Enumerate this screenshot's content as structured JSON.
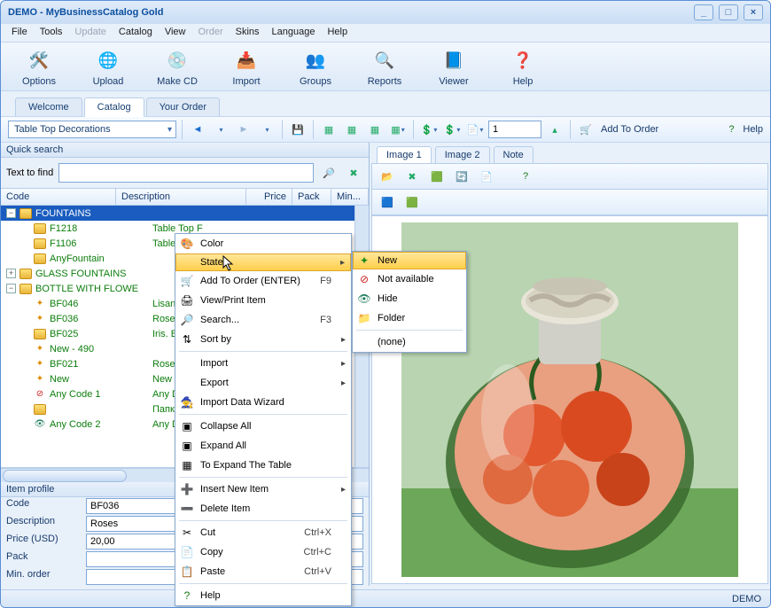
{
  "title": "DEMO - MyBusinessCatalog Gold",
  "menu": {
    "file": "File",
    "tools": "Tools",
    "update": "Update",
    "catalog": "Catalog",
    "view": "View",
    "order": "Order",
    "skins": "Skins",
    "language": "Language",
    "help": "Help"
  },
  "toolbar": {
    "options": "Options",
    "upload": "Upload",
    "makecd": "Make CD",
    "import": "Import",
    "groups": "Groups",
    "reports": "Reports",
    "viewer": "Viewer",
    "help": "Help"
  },
  "tabs": {
    "welcome": "Welcome",
    "catalog": "Catalog",
    "yourorder": "Your Order"
  },
  "cmdbar": {
    "category": "Table Top Decorations",
    "qty": "1",
    "addtoorder": "Add To Order",
    "help": "Help"
  },
  "quicksearch": {
    "title": "Quick search",
    "texttofind": "Text to find"
  },
  "grid": {
    "code": "Code",
    "description": "Description",
    "price": "Price",
    "pack": "Pack",
    "min": "Min..."
  },
  "tree": [
    {
      "indent": 0,
      "toggle": "−",
      "folder": true,
      "code": "FOUNTAINS",
      "desc": "",
      "sel": true
    },
    {
      "indent": 1,
      "folder": true,
      "code": "F1218",
      "desc": "Table Top F"
    },
    {
      "indent": 1,
      "folder": true,
      "code": "F1106",
      "desc": "Table Top F"
    },
    {
      "indent": 1,
      "folder": true,
      "code": "AnyFountain",
      "desc": ""
    },
    {
      "indent": 0,
      "toggle": "+",
      "folder": true,
      "code": "GLASS FOUNTAINS",
      "desc": ""
    },
    {
      "indent": 0,
      "toggle": "−",
      "folder": true,
      "code": "BOTTLE WITH FLOWERS",
      "desc": ""
    },
    {
      "indent": 1,
      "state": "new",
      "code": "BF046",
      "desc": "Lisantus. Lil"
    },
    {
      "indent": 1,
      "state": "new",
      "code": "BF036",
      "desc": "Roses"
    },
    {
      "indent": 1,
      "folder": true,
      "code": "BF025",
      "desc": "Iris. Bordo"
    },
    {
      "indent": 1,
      "state": "new",
      "code": "New - 490",
      "desc": ""
    },
    {
      "indent": 1,
      "state": "new",
      "code": "BF021",
      "desc": "Roses. Red"
    },
    {
      "indent": 1,
      "state": "new",
      "code": "New",
      "desc": "New Item"
    },
    {
      "indent": 1,
      "state": "no",
      "code": "Any Code 1",
      "desc": "Any Descrip"
    },
    {
      "indent": 1,
      "folder": true,
      "code": "",
      "desc": "Папка 1"
    },
    {
      "indent": 1,
      "state": "hide",
      "code": "Any Code 2",
      "desc": "Any Descrip"
    }
  ],
  "profile": {
    "title": "Item profile",
    "code_l": "Code",
    "code_v": "BF036",
    "desc_l": "Description",
    "desc_v": "Roses",
    "price_l": "Price (USD)",
    "price_v": "20,00",
    "pack_l": "Pack",
    "pack_v": "",
    "min_l": "Min. order",
    "min_v": ""
  },
  "imgtabs": {
    "image1": "Image 1",
    "image2": "Image 2",
    "note": "Note"
  },
  "status": "DEMO",
  "ctx": {
    "color": "Color",
    "state": "State",
    "addtoorder": "Add To Order (ENTER)",
    "addtoorder_sc": "F9",
    "viewprint": "View/Print Item",
    "search": "Search...",
    "search_sc": "F3",
    "sortby": "Sort by",
    "import": "Import",
    "export": "Export",
    "importwiz": "Import Data Wizard",
    "collapse": "Collapse All",
    "expand": "Expand All",
    "toexpand": "To Expand The Table",
    "insertnew": "Insert New Item",
    "delete": "Delete Item",
    "cut": "Cut",
    "cut_sc": "Ctrl+X",
    "copy": "Copy",
    "copy_sc": "Ctrl+C",
    "paste": "Paste",
    "paste_sc": "Ctrl+V",
    "help": "Help"
  },
  "sub": {
    "new": "New",
    "notavail": "Not available",
    "hide": "Hide",
    "folder": "Folder",
    "none": "(none)"
  }
}
